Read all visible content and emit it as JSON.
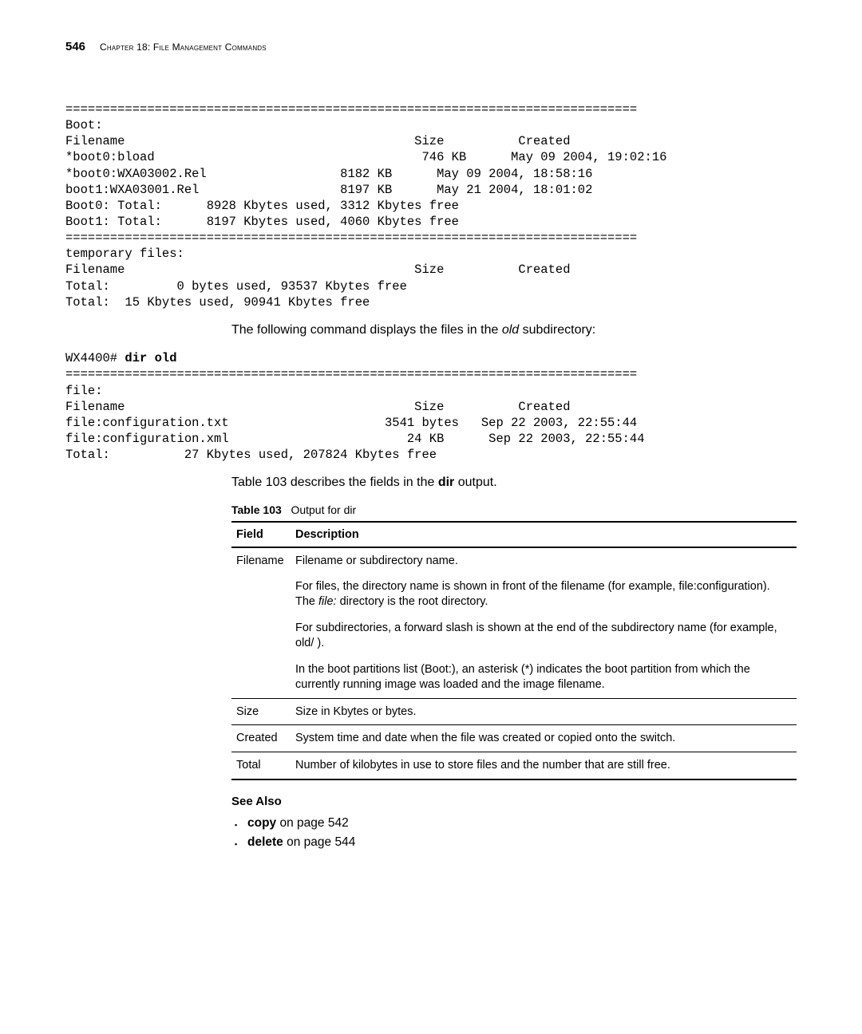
{
  "header": {
    "page_number": "546",
    "chapter_title": "Chapter 18: File Management Commands"
  },
  "codeblock1": "=============================================================================\nBoot:\nFilename                                       Size          Created\n*boot0:bload                                    746 KB      May 09 2004, 19:02:16\n*boot0:WXA03002.Rel                  8182 KB      May 09 2004, 18:58:16\nboot1:WXA03001.Rel                   8197 KB      May 21 2004, 18:01:02\nBoot0: Total:      8928 Kbytes used, 3312 Kbytes free\nBoot1: Total:      8197 Kbytes used, 4060 Kbytes free\n=============================================================================\ntemporary files:\nFilename                                       Size          Created\nTotal:         0 bytes used, 93537 Kbytes free\nTotal:  15 Kbytes used, 90941 Kbytes free",
  "body1_prefix": "The following command displays the files in the ",
  "body1_italic": "old",
  "body1_suffix": " subdirectory:",
  "codeblock2_prefix": "WX4400# ",
  "codeblock2_cmd": "dir old",
  "codeblock2_rest": "=============================================================================\nfile:\nFilename                                       Size          Created\nfile:configuration.txt                     3541 bytes   Sep 22 2003, 22:55:44\nfile:configuration.xml                        24 KB      Sep 22 2003, 22:55:44\nTotal:          27 Kbytes used, 207824 Kbytes free",
  "body2_prefix": "Table 103 describes the fields in the ",
  "body2_bold": "dir",
  "body2_suffix": " output.",
  "table": {
    "caption_label": "Table 103",
    "caption_text": "Output for dir",
    "head_field": "Field",
    "head_desc": "Description",
    "rows": [
      {
        "field": "Filename",
        "desc_parts": [
          "Filename or subdirectory name.",
          "For files, the directory name is shown in front of the filename (for example, file:configuration). The ",
          "file:",
          " directory is the root directory.",
          "For subdirectories, a forward slash is shown at the end of the subdirectory name (for example, old/ ).",
          "In the boot partitions list (Boot:), an asterisk (*) indicates the boot partition from which the currently running image was loaded and the image filename."
        ]
      },
      {
        "field": "Size",
        "desc": "Size in Kbytes or bytes."
      },
      {
        "field": "Created",
        "desc": "System time and date when the file was created or copied onto the switch."
      },
      {
        "field": "Total",
        "desc": "Number of kilobytes in use to store files and the number that are still free."
      }
    ]
  },
  "see_also": {
    "heading": "See Also",
    "items": [
      {
        "cmd": "copy",
        "rest": " on page 542"
      },
      {
        "cmd": "delete",
        "rest": " on page 544"
      }
    ]
  }
}
